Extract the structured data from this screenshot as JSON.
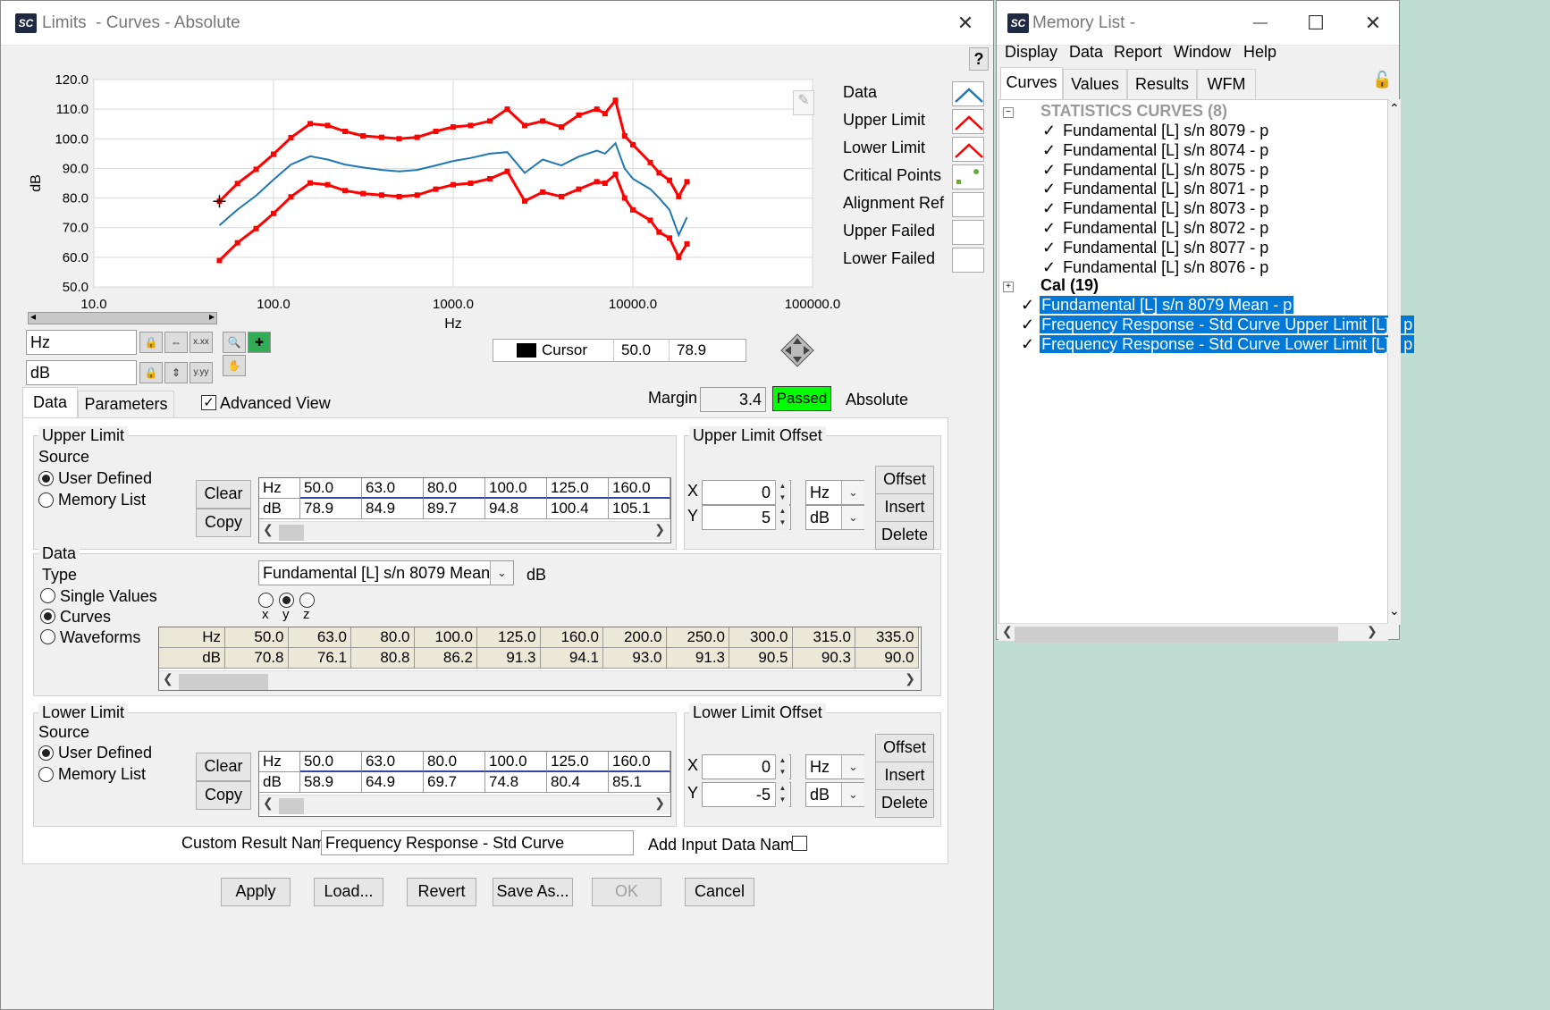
{
  "limits_window": {
    "title": "Limits  - Curves - Absolute",
    "logo": "SC",
    "help_label": "?",
    "close_label": "✕",
    "legend": [
      {
        "label": "Data",
        "color": "#1f77b4"
      },
      {
        "label": "Upper Limit",
        "color": "#ff0000"
      },
      {
        "label": "Lower Limit",
        "color": "#ff0000"
      },
      {
        "label": "Critical Points",
        "color": "#6aaa3a"
      },
      {
        "label": "Alignment Ref",
        "color": ""
      },
      {
        "label": "Upper Failed",
        "color": ""
      },
      {
        "label": "Lower Failed",
        "color": ""
      }
    ],
    "x_axis_field": "Hz",
    "y_axis_field": "dB",
    "cursor": {
      "label": "Cursor",
      "x": "50.0",
      "y": "78.9"
    },
    "tabs": [
      "Data",
      "Parameters"
    ],
    "advanced_view_label": "Advanced View",
    "margin_label": "Margin",
    "margin_value": "3.4",
    "status": "Passed",
    "status_color": "#00ff00",
    "mode_label": "Absolute",
    "upper_limit": {
      "title": "Upper Limit",
      "source_label": "Source",
      "options": [
        "User Defined",
        "Memory List"
      ],
      "selected": "User Defined",
      "clear_label": "Clear",
      "copy_label": "Copy",
      "row_labels": [
        "Hz",
        "dB"
      ],
      "hz": [
        "50.0",
        "63.0",
        "80.0",
        "100.0",
        "125.0",
        "160.0"
      ],
      "db": [
        "78.9",
        "84.9",
        "89.7",
        "94.8",
        "100.4",
        "105.1"
      ]
    },
    "upper_offset": {
      "title": "Upper Limit Offset",
      "x_label": "X",
      "x_value": "0",
      "x_unit": "Hz",
      "y_label": "Y",
      "y_value": "5",
      "y_unit": "dB",
      "offset_label": "Offset",
      "insert_label": "Insert",
      "delete_label": "Delete"
    },
    "data_group": {
      "title": "Data",
      "type_label": "Type",
      "options": [
        "Single Values",
        "Curves",
        "Waveforms"
      ],
      "selected": "Curves",
      "curve_select": "Fundamental [L] s/n 8079 Mean - p",
      "unit": "dB",
      "axis_options": [
        "x",
        "y",
        "z"
      ],
      "axis_selected": "y",
      "row_labels": [
        "Hz",
        "dB"
      ],
      "hz": [
        "50.0",
        "63.0",
        "80.0",
        "100.0",
        "125.0",
        "160.0",
        "200.0",
        "250.0",
        "300.0",
        "315.0",
        "335.0"
      ],
      "db": [
        "70.8",
        "76.1",
        "80.8",
        "86.2",
        "91.3",
        "94.1",
        "93.0",
        "91.3",
        "90.5",
        "90.3",
        "90.0"
      ]
    },
    "lower_limit": {
      "title": "Lower Limit",
      "source_label": "Source",
      "options": [
        "User Defined",
        "Memory List"
      ],
      "selected": "User Defined",
      "clear_label": "Clear",
      "copy_label": "Copy",
      "row_labels": [
        "Hz",
        "dB"
      ],
      "hz": [
        "50.0",
        "63.0",
        "80.0",
        "100.0",
        "125.0",
        "160.0"
      ],
      "db": [
        "58.9",
        "64.9",
        "69.7",
        "74.8",
        "80.4",
        "85.1"
      ]
    },
    "lower_offset": {
      "title": "Lower Limit Offset",
      "x_label": "X",
      "x_value": "0",
      "x_unit": "Hz",
      "y_label": "Y",
      "y_value": "-5",
      "y_unit": "dB",
      "offset_label": "Offset",
      "insert_label": "Insert",
      "delete_label": "Delete"
    },
    "custom_result_label": "Custom Result Name",
    "custom_result_value": "Frequency Response - Std Curve",
    "add_input_label": "Add Input Data Name",
    "buttons": {
      "apply": "Apply",
      "load": "Load...",
      "revert": "Revert",
      "save_as": "Save As...",
      "ok": "OK",
      "cancel": "Cancel"
    }
  },
  "chart_data": {
    "type": "line",
    "xlabel": "Hz",
    "ylabel": "dB",
    "x_scale": "log",
    "xlim": [
      10,
      100000
    ],
    "ylim": [
      50,
      120
    ],
    "x_ticks": [
      "10.0",
      "100.0",
      "1000.0",
      "10000.0",
      "100000.0"
    ],
    "y_ticks": [
      "120.0",
      "110.0",
      "100.0",
      "90.0",
      "80.0",
      "70.0",
      "60.0",
      "50.0"
    ],
    "x": [
      50,
      63,
      80,
      100,
      125,
      160,
      200,
      250,
      315,
      400,
      500,
      630,
      800,
      1000,
      1250,
      1600,
      2000,
      2500,
      3150,
      4000,
      5000,
      6300,
      7000,
      8000,
      9000,
      10000,
      12500,
      14000,
      16000,
      18000,
      20000
    ],
    "series": [
      {
        "name": "Data",
        "color": "#1f77b4",
        "values": [
          70.8,
          76.1,
          80.8,
          86.2,
          91.3,
          94.1,
          93.0,
          91.3,
          90.3,
          89.5,
          89.0,
          89.5,
          91.0,
          92.5,
          93.5,
          95.0,
          95.5,
          88.5,
          93.0,
          91.0,
          94.0,
          96.0,
          95.0,
          98.5,
          90.0,
          86.5,
          83.0,
          80.0,
          76.0,
          67.5,
          73.5
        ]
      },
      {
        "name": "Upper Limit",
        "color": "#ff0000",
        "values": [
          78.9,
          84.9,
          89.7,
          94.8,
          100.4,
          105.1,
          104.5,
          102.5,
          101.0,
          100.5,
          100.0,
          100.5,
          102.5,
          104.0,
          104.5,
          106.0,
          110.0,
          104.5,
          106.0,
          104.0,
          108.0,
          110.0,
          108.5,
          113.0,
          101.0,
          98.0,
          92.0,
          88.5,
          86.0,
          80.5,
          85.5
        ]
      },
      {
        "name": "Lower Limit",
        "color": "#ff0000",
        "values": [
          58.9,
          64.9,
          69.7,
          74.8,
          80.4,
          85.1,
          84.5,
          82.5,
          81.5,
          81.0,
          80.5,
          81.0,
          83.0,
          84.5,
          85.0,
          86.5,
          89.0,
          79.0,
          82.0,
          80.5,
          83.0,
          85.5,
          85.0,
          88.0,
          80.0,
          76.0,
          72.5,
          68.5,
          66.5,
          60.0,
          64.5
        ]
      }
    ]
  },
  "memory_list": {
    "title": "Memory List -",
    "logo": "SC",
    "minimize_label": "—",
    "maximize_label": "☐",
    "close_label": "✕",
    "menu": [
      "Display",
      "Data",
      "Report",
      "Window",
      "Help"
    ],
    "tabs": [
      "Curves",
      "Values",
      "Results",
      "WFM"
    ],
    "group_stats": "STATISTICS CURVES (8)",
    "stat_items": [
      "Fundamental [L] s/n 8079 - p",
      "Fundamental [L] s/n 8074 - p",
      "Fundamental [L] s/n 8075 - p",
      "Fundamental [L] s/n 8071 - p",
      "Fundamental [L] s/n 8073 - p",
      "Fundamental [L] s/n 8072 - p",
      "Fundamental [L] s/n 8077 - p",
      "Fundamental [L] s/n 8076 - p"
    ],
    "group_cal": "Cal (19)",
    "selected_items": [
      "Fundamental [L] s/n 8079 Mean - p",
      "Frequency Response - Std Curve Upper Limit [L] - p",
      "Frequency Response - Std Curve Lower Limit [L] - p"
    ]
  }
}
